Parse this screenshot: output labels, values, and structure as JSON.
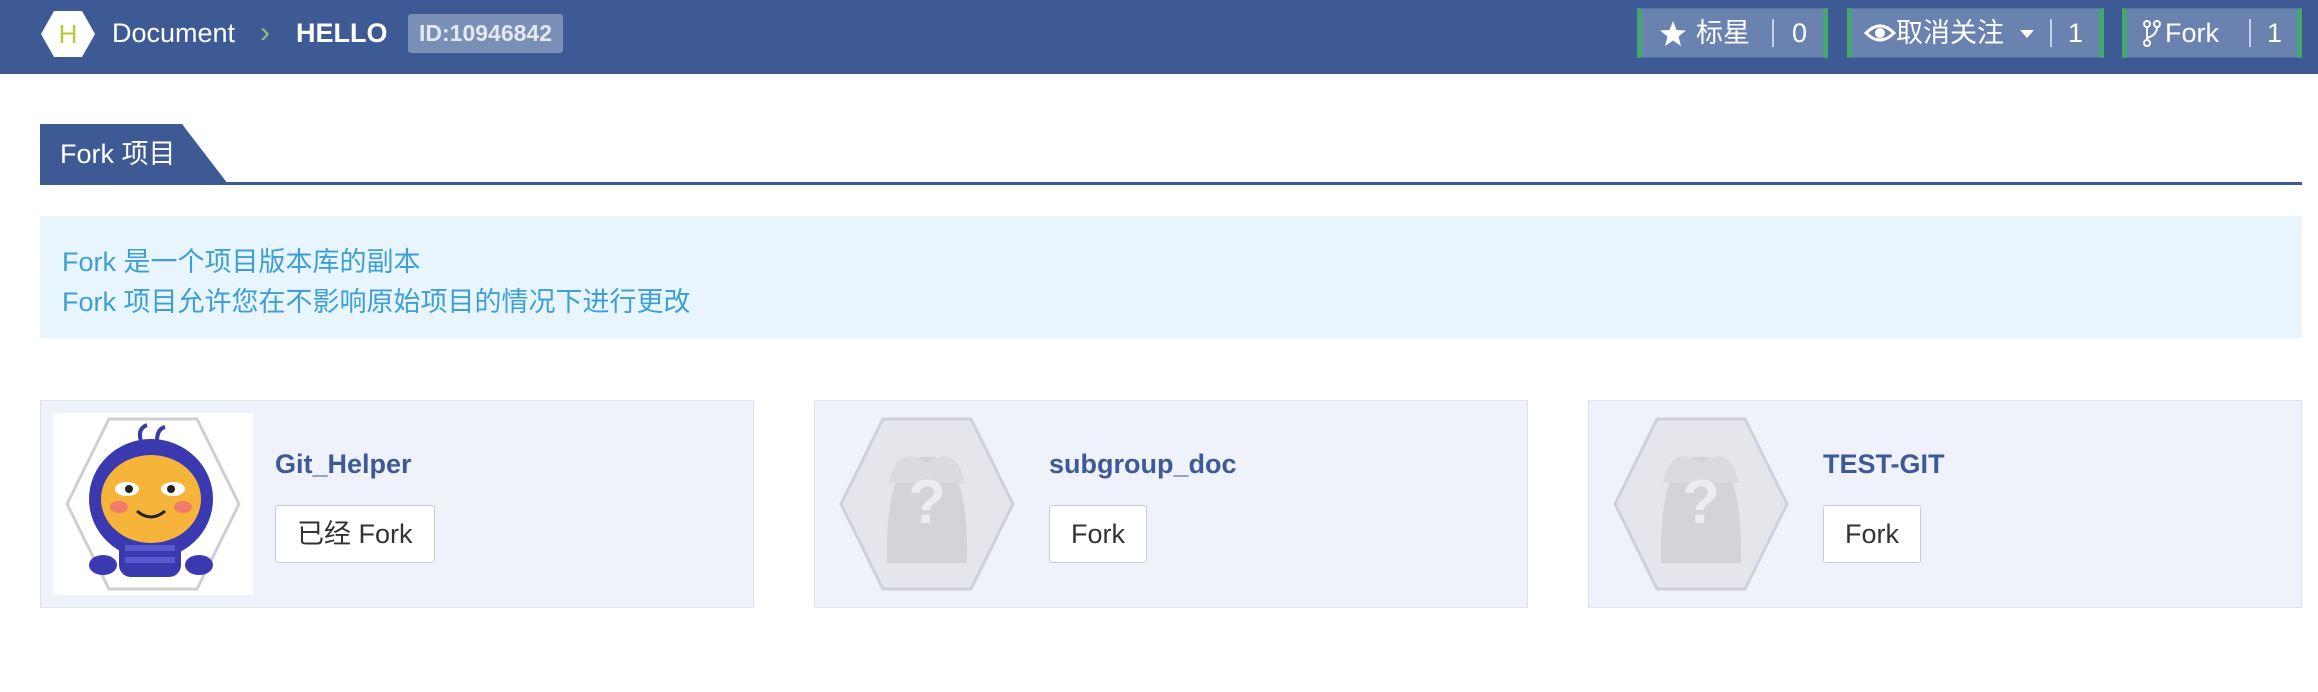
{
  "header": {
    "logo_letter": "H",
    "breadcrumb_root": "Document",
    "breadcrumb_separator": "›",
    "breadcrumb_current": "HELLO",
    "id_badge": "ID:10946842",
    "star": {
      "label": "标星",
      "count": "0",
      "icon": "star-icon"
    },
    "watch": {
      "label": "取消关注",
      "count": "1",
      "icon": "eye-icon"
    },
    "fork": {
      "label": "Fork",
      "count": "1",
      "icon": "fork-icon"
    }
  },
  "tab": {
    "label": "Fork 项目"
  },
  "info": {
    "line1": "Fork 是一个项目版本库的副本",
    "line2": "Fork 项目允许您在不影响原始项目的情况下进行更改"
  },
  "cards": [
    {
      "name": "Git_Helper",
      "button": "已经 Fork",
      "avatar": "cartoon-avatar"
    },
    {
      "name": "subgroup_doc",
      "button": "Fork",
      "avatar": "placeholder-avatar"
    },
    {
      "name": "TEST-GIT",
      "button": "Fork",
      "avatar": "placeholder-avatar"
    }
  ],
  "colors": {
    "header_bg": "#3d5a94",
    "button_bg": "#6a82b0",
    "info_bg": "#e9f5fc",
    "info_text": "#3f9fd4",
    "card_bg": "#eff2fa"
  }
}
